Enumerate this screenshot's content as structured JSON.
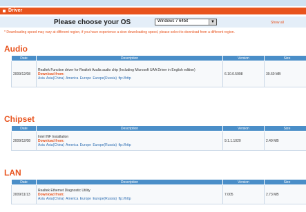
{
  "header": {
    "title": "Driver"
  },
  "os_selector": {
    "prompt": "Please choose your OS",
    "selected": "Windows 7 64bit",
    "show_all": "Show all"
  },
  "note": "* Downloading speed may vary at different region, if you have experience a slow downloading speed, please select to download from a different region.",
  "columns": {
    "date": "Date",
    "description": "Description",
    "version": "Version",
    "size": "Size"
  },
  "sections": [
    {
      "title": "Audio",
      "rows": [
        {
          "date": "2009/12/08",
          "description": "Realtek Function driver for Realtek Azalia audio chip (Including Microsoft UAA Driver in English edition)",
          "download": "Download from:",
          "mirrors": "Asia  Asia(China)  America  Europe  Europe(Russia)  ftp://http",
          "version": "6.10.0.5998",
          "size": "39.60 MB"
        }
      ]
    },
    {
      "title": "Chipset",
      "rows": [
        {
          "date": "2009/12/08",
          "description": "Intel INF Installation",
          "download": "Download from:",
          "mirrors": "Asia  Asia(China)  America  Europe  Europe(Russia)  ftp://http",
          "version": "9.1.1.1020",
          "size": "2.49 MB"
        }
      ]
    },
    {
      "title": "LAN",
      "rows": [
        {
          "date": "2009/11/13",
          "description": "Realtek Ethernet Diagnostic Utility",
          "download": "Download from:",
          "mirrors": "Asia  Asia(China)  America  Europe  Europe(Russia)  ftp://http",
          "version": "7.005",
          "size": "2.73 MB"
        }
      ]
    }
  ]
}
